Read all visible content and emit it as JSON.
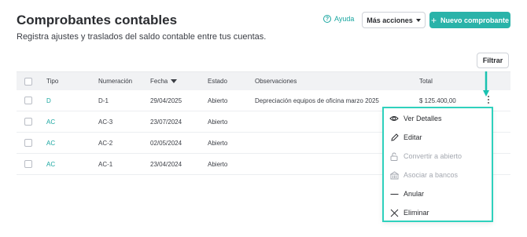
{
  "header": {
    "title": "Comprobantes contables",
    "subtitle": "Registra ajustes y traslados del saldo contable entre tus cuentas.",
    "help_label": "Ayuda",
    "more_actions_label": "Más acciones",
    "new_button_label": "Nuevo comprobante"
  },
  "filter_label": "Filtrar",
  "table": {
    "columns": {
      "tipo": "Tipo",
      "numeracion": "Numeración",
      "fecha": "Fecha",
      "estado": "Estado",
      "observaciones": "Observaciones",
      "total": "Total"
    },
    "rows": [
      {
        "tipo": "D",
        "numeracion": "D-1",
        "fecha": "29/04/2025",
        "estado": "Abierto",
        "observaciones": "Depreciación equipos de oficina marzo 2025",
        "total": "$ 125.400,00"
      },
      {
        "tipo": "AC",
        "numeracion": "AC-3",
        "fecha": "23/07/2024",
        "estado": "Abierto",
        "observaciones": "",
        "total": ""
      },
      {
        "tipo": "AC",
        "numeracion": "AC-2",
        "fecha": "02/05/2024",
        "estado": "Abierto",
        "observaciones": "",
        "total": ""
      },
      {
        "tipo": "AC",
        "numeracion": "AC-1",
        "fecha": "23/04/2024",
        "estado": "Abierto",
        "observaciones": "",
        "total": ""
      }
    ]
  },
  "menu": {
    "items": [
      {
        "label": "Ver Detalles",
        "icon": "eye-icon",
        "disabled": false
      },
      {
        "label": "Editar",
        "icon": "pencil-icon",
        "disabled": false
      },
      {
        "label": "Convertir a abierto",
        "icon": "unlock-icon",
        "disabled": true
      },
      {
        "label": "Asociar a bancos",
        "icon": "bank-icon",
        "disabled": true
      },
      {
        "label": "Anular",
        "icon": "dash-icon",
        "disabled": false
      },
      {
        "label": "Eliminar",
        "icon": "close-icon",
        "disabled": false
      }
    ]
  },
  "colors": {
    "accent": "#2ab3a9",
    "link": "#19a6a0",
    "highlight": "#2fd1bd"
  }
}
